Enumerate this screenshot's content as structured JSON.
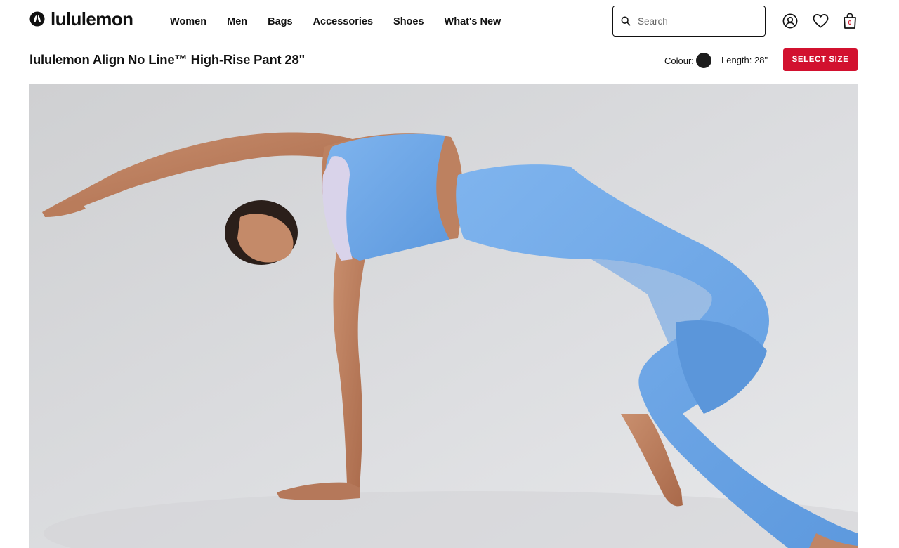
{
  "brand": {
    "name": "lululemon",
    "logo_icon": "lululemon-logo-icon"
  },
  "nav": {
    "links": [
      {
        "label": "Women"
      },
      {
        "label": "Men"
      },
      {
        "label": "Bags"
      },
      {
        "label": "Accessories"
      },
      {
        "label": "Shoes"
      },
      {
        "label": "What's New"
      }
    ]
  },
  "search": {
    "placeholder": "Search",
    "value": "",
    "icon": "search-icon"
  },
  "header_icons": {
    "account": "account-icon",
    "wishlist": "heart-icon",
    "bag": "shopping-bag-icon",
    "bag_count": "0"
  },
  "product_bar": {
    "title": "lululemon Align No Line™ High-Rise Pant 28\"",
    "colour_label": "Colour:",
    "colour_swatch": "#1c1c1c",
    "length_label": "Length: 28\"",
    "select_size_label": "SELECT SIZE"
  },
  "colors": {
    "accent_red": "#d2112f",
    "pant_blue": "#6fa9e8",
    "backdrop": "#d9dadc"
  }
}
